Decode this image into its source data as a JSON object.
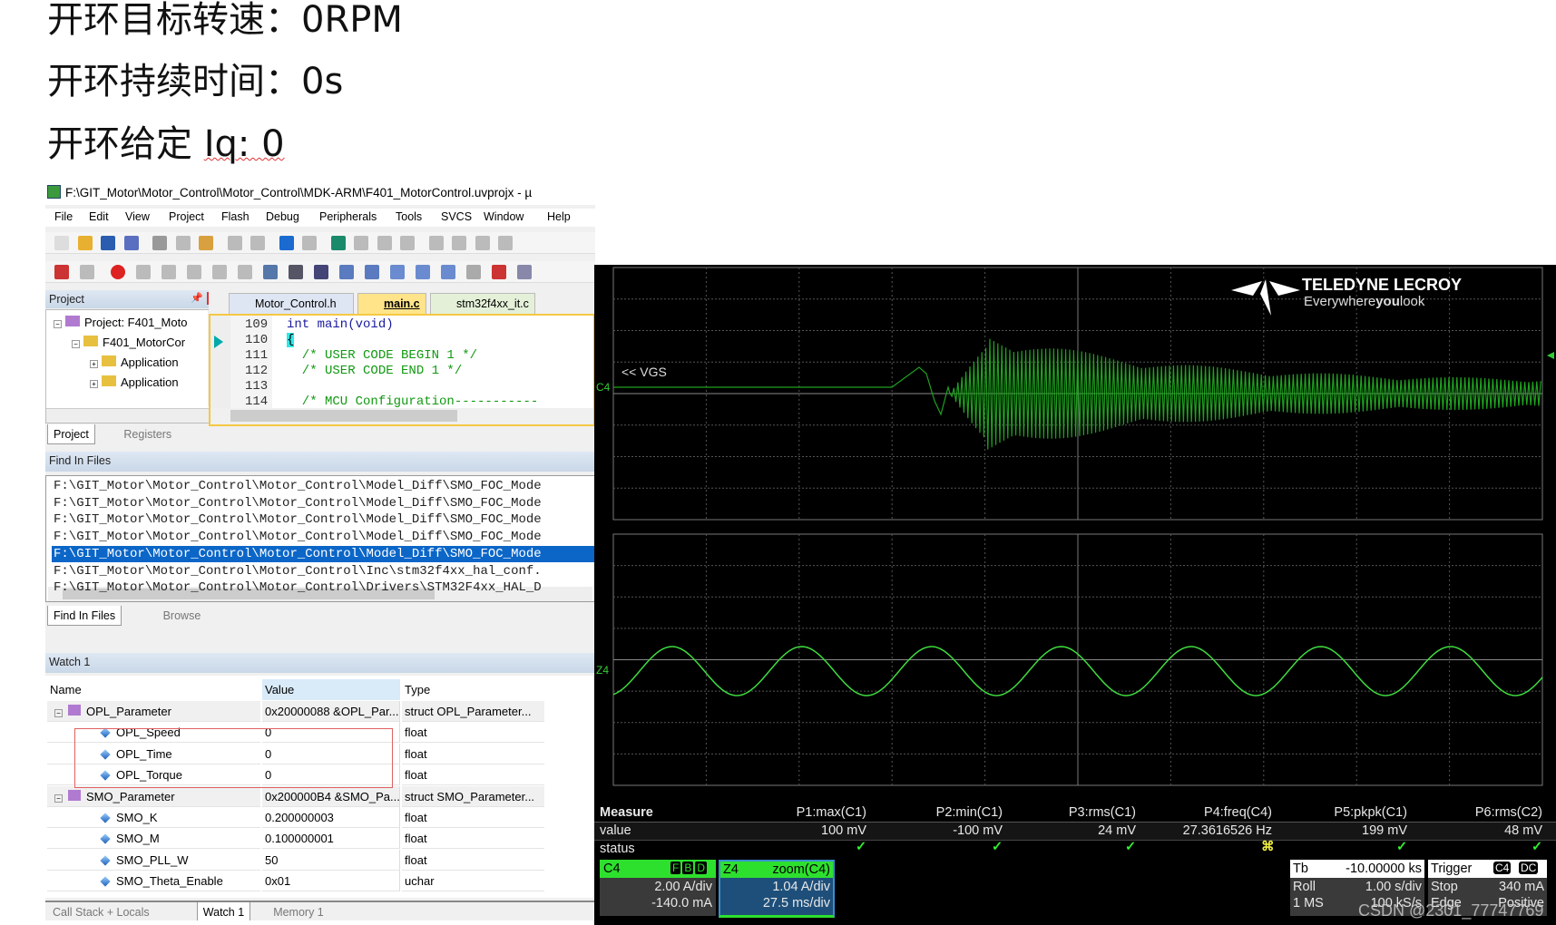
{
  "notes": [
    {
      "label": "开环目标转速：",
      "value": "0RPM"
    },
    {
      "label": "开环持续时间：",
      "value": "0s"
    },
    {
      "label": "开环给定 ",
      "value": "Iq: 0"
    }
  ],
  "ide": {
    "title": "F:\\GIT_Motor\\Motor_Control\\Motor_Control\\MDK-ARM\\F401_MotorControl.uvprojx - µ",
    "menu": [
      "File",
      "Edit",
      "View",
      "Project",
      "Flash",
      "Debug",
      "Peripherals",
      "Tools",
      "SVCS",
      "Window",
      "Help"
    ],
    "project_panel": {
      "title": "Project",
      "tree": [
        "Project: F401_Moto",
        "F401_MotorCor",
        "Application",
        "Application"
      ],
      "tabs": [
        "Project",
        "Registers"
      ]
    },
    "editor": {
      "tabs": [
        "Motor_Control.h",
        "main.c",
        "stm32f4xx_it.c"
      ],
      "active_tab": "main.c",
      "lines": [
        {
          "num": "109",
          "code": "int main(void)"
        },
        {
          "num": "110",
          "code": "{"
        },
        {
          "num": "111",
          "code": "  /* USER CODE BEGIN 1 */"
        },
        {
          "num": "112",
          "code": "  /* USER CODE END 1 */"
        },
        {
          "num": "113",
          "code": ""
        },
        {
          "num": "114",
          "code": "  /* MCU Configuration-----------"
        }
      ]
    },
    "find_in_files": {
      "title": "Find In Files",
      "selected": 4,
      "results": [
        "F:\\GIT_Motor\\Motor_Control\\Motor_Control\\Model_Diff\\SMO_FOC_Mode",
        "F:\\GIT_Motor\\Motor_Control\\Motor_Control\\Model_Diff\\SMO_FOC_Mode",
        "F:\\GIT_Motor\\Motor_Control\\Motor_Control\\Model_Diff\\SMO_FOC_Mode",
        "F:\\GIT_Motor\\Motor_Control\\Motor_Control\\Model_Diff\\SMO_FOC_Mode",
        "F:\\GIT_Motor\\Motor_Control\\Motor_Control\\Model_Diff\\SMO_FOC_Mode",
        "F:\\GIT_Motor\\Motor_Control\\Motor_Control\\Inc\\stm32f4xx_hal_conf.",
        "F:\\GIT_Motor\\Motor_Control\\Motor_Control\\Drivers\\STM32F4xx_HAL_D"
      ],
      "tabs": [
        "Find In Files",
        "Browse"
      ]
    },
    "watch": {
      "title": "Watch 1",
      "columns": [
        "Name",
        "Value",
        "Type"
      ],
      "rows": [
        {
          "name": "OPL_Parameter",
          "value": "0x20000088 &OPL_Par...",
          "type": "struct OPL_Parameter...",
          "level": 0
        },
        {
          "name": "OPL_Speed",
          "value": "0",
          "type": "float",
          "level": 1
        },
        {
          "name": "OPL_Time",
          "value": "0",
          "type": "float",
          "level": 1
        },
        {
          "name": "OPL_Torque",
          "value": "0",
          "type": "float",
          "level": 1
        },
        {
          "name": "SMO_Parameter",
          "value": "0x200000B4 &SMO_Pa...",
          "type": "struct SMO_Parameter...",
          "level": 0
        },
        {
          "name": "SMO_K",
          "value": "0.200000003",
          "type": "float",
          "level": 1
        },
        {
          "name": "SMO_M",
          "value": "0.100000001",
          "type": "float",
          "level": 1
        },
        {
          "name": "SMO_PLL_W",
          "value": "50",
          "type": "float",
          "level": 1
        },
        {
          "name": "SMO_Theta_Enable",
          "value": "0x01",
          "type": "uchar",
          "level": 1
        }
      ],
      "tabs": [
        "Call Stack + Locals",
        "Watch 1",
        "Memory 1"
      ]
    }
  },
  "scope": {
    "brand": "TELEDYNE LECROY",
    "slogan_a": "Everywhere",
    "slogan_b": "you",
    "slogan_c": "look",
    "trace_label": "<< VGS",
    "ch_upper": "C4",
    "ch_lower": "Z4",
    "trace_color": "#1fa01f",
    "zoom_color": "#3fdc3f",
    "measure": {
      "header": "Measure",
      "value_label": "value",
      "status_label": "status",
      "params": [
        {
          "name": "P1:max(C1)",
          "value": "100 mV",
          "status": "ok"
        },
        {
          "name": "P2:min(C1)",
          "value": "-100 mV",
          "status": "ok"
        },
        {
          "name": "P3:rms(C1)",
          "value": "24 mV",
          "status": "ok"
        },
        {
          "name": "P4:freq(C4)",
          "value": "27.3616526 Hz",
          "status": "warn"
        },
        {
          "name": "P5:pkpk(C1)",
          "value": "199 mV",
          "status": "ok"
        },
        {
          "name": "P6:rms(C2)",
          "value": "48 mV",
          "status": "ok"
        }
      ]
    },
    "c4": {
      "label": "C4",
      "flags": [
        "F",
        "B",
        "D"
      ],
      "scale": "2.00 A/div",
      "offset": "-140.0 mA"
    },
    "z4": {
      "label": "Z4",
      "source": "zoom(C4)",
      "scale": "1.04 A/div",
      "time": "27.5 ms/div"
    },
    "tb": {
      "label": "Tb",
      "delay": "-10.00000 ks",
      "mode": "Roll",
      "tdiv": "1.00 s/div",
      "mem": "1 MS",
      "rate": "100 kS/s"
    },
    "trigger": {
      "label": "Trigger",
      "ch": "C4",
      "coupling": "DC",
      "state": "Stop",
      "level": "340 mA",
      "type": "Edge",
      "slope": "Positive"
    }
  },
  "watermark": "CSDN @2301_77747769"
}
